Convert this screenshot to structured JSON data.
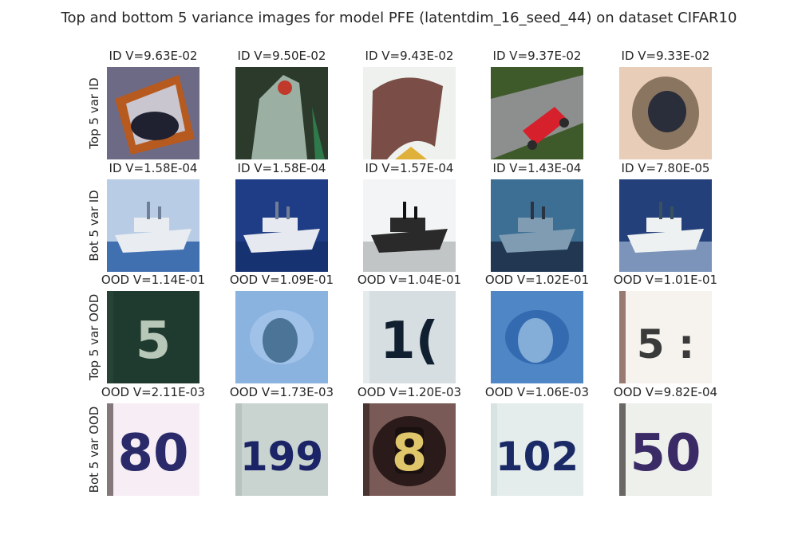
{
  "chart_data": {
    "type": "image_grid",
    "title": "Top and bottom 5 variance images for model PFE (latentdim_16_seed_44) on dataset CIFAR10",
    "rows": [
      {
        "label": "Top 5 var ID",
        "cells": [
          {
            "title": "ID V=9.63E-02",
            "variance": 0.0963,
            "icon": "cluttered-object-image",
            "palette": {
              "bg": "#6d6a86",
              "fg": "#c9c6cf",
              "accent": "#b65a1f",
              "dark": "#1f2030"
            }
          },
          {
            "title": "ID V=9.50E-02",
            "variance": 0.095,
            "icon": "parrot-image",
            "palette": {
              "bg": "#2b3a2a",
              "fg": "#9bb0a2",
              "accent": "#c0392b",
              "dark": "#2f7a4a"
            }
          },
          {
            "title": "ID V=9.43E-02",
            "variance": 0.0943,
            "icon": "bird-head-image",
            "palette": {
              "bg": "#eef1ee",
              "fg": "#7a4e46",
              "accent": "#e0b13a",
              "dark": "#5c4f22"
            }
          },
          {
            "title": "ID V=9.37E-02",
            "variance": 0.0937,
            "icon": "red-car-image",
            "palette": {
              "bg": "#3f5a2a",
              "fg": "#8c8f8e",
              "accent": "#d6202c",
              "dark": "#2a2a2a"
            }
          },
          {
            "title": "ID V=9.33E-02",
            "variance": 0.0933,
            "icon": "dog-face-image",
            "palette": {
              "bg": "#e8cdb8",
              "fg": "#8a7560",
              "accent": "#2a2d3a",
              "dark": "#5a4a3f"
            }
          }
        ]
      },
      {
        "label": "Bot 5 var ID",
        "cells": [
          {
            "title": "ID V=1.58E-04",
            "variance": 0.000158,
            "icon": "ship-image",
            "palette": {
              "bg": "#b9cce6",
              "fg": "#e9ecf0",
              "accent": "#2b5fa6",
              "dark": "#6f7f96"
            }
          },
          {
            "title": "ID V=1.58E-04",
            "variance": 0.000158,
            "icon": "ship-image",
            "palette": {
              "bg": "#1f3d86",
              "fg": "#e6e9ef",
              "accent": "#16306d",
              "dark": "#6f7d95"
            }
          },
          {
            "title": "ID V=1.57E-04",
            "variance": 0.000157,
            "icon": "ship-image",
            "palette": {
              "bg": "#f2f4f5",
              "fg": "#2a2a2a",
              "accent": "#b9bcbd",
              "dark": "#111111"
            }
          },
          {
            "title": "ID V=1.43E-04",
            "variance": 0.000143,
            "icon": "ship-image",
            "palette": {
              "bg": "#3d6f94",
              "fg": "#7f9cb2",
              "accent": "#1d2e46",
              "dark": "#2a3342"
            }
          },
          {
            "title": "ID V=7.80E-05",
            "variance": 7.8e-05,
            "icon": "ship-image",
            "palette": {
              "bg": "#24407a",
              "fg": "#eef1f2",
              "accent": "#8ca3c6",
              "dark": "#39515f"
            }
          }
        ]
      },
      {
        "label": "Top 5 var OOD",
        "cells": [
          {
            "title": "OOD V=1.14E-01",
            "variance": 0.114,
            "icon": "digit-image",
            "digits": "5",
            "palette": {
              "bg": "#1f3a2e",
              "fg": "#b8c8b8",
              "accent": "#2c4a3a",
              "dark": "#0f2018"
            }
          },
          {
            "title": "OOD V=1.09E-01",
            "variance": 0.109,
            "icon": "blurry-digit-image",
            "digits": "",
            "palette": {
              "bg": "#8bb3e0",
              "fg": "#2f5a7a",
              "accent": "#aac9ec",
              "dark": "#3d6a8a"
            }
          },
          {
            "title": "OOD V=1.04E-01",
            "variance": 0.104,
            "icon": "digit-image",
            "digits": "1(",
            "palette": {
              "bg": "#d6dee2",
              "fg": "#102030",
              "accent": "#eef2f4",
              "dark": "#0b1520"
            }
          },
          {
            "title": "OOD V=1.02E-01",
            "variance": 0.102,
            "icon": "blurry-digit-image",
            "digits": "",
            "palette": {
              "bg": "#4f86c6",
              "fg": "#9fc3e6",
              "accent": "#2a5fa6",
              "dark": "#6f9fd2"
            }
          },
          {
            "title": "OOD V=1.01E-01",
            "variance": 0.101,
            "icon": "digit-image",
            "digits": "5 :",
            "palette": {
              "bg": "#f6f3ee",
              "fg": "#3a3a3a",
              "accent": "#5a2a22",
              "dark": "#2a1410"
            }
          }
        ]
      },
      {
        "label": "Bot 5 var OOD",
        "cells": [
          {
            "title": "OOD V=2.11E-03",
            "variance": 0.00211,
            "icon": "digit-image",
            "digits": "80",
            "palette": {
              "bg": "#f6eef4",
              "fg": "#2a2a6a",
              "accent": "#3a2a2a",
              "dark": "#2a1a2a"
            }
          },
          {
            "title": "OOD V=1.73E-03",
            "variance": 0.00173,
            "icon": "digit-image",
            "digits": "199",
            "palette": {
              "bg": "#c9d3cf",
              "fg": "#1a2466",
              "accent": "#aeb9b6",
              "dark": "#13194a"
            }
          },
          {
            "title": "OOD V=1.20E-03",
            "variance": 0.0012,
            "icon": "digit-plate-image",
            "digits": "8",
            "palette": {
              "bg": "#7a5a56",
              "fg": "#e0c66a",
              "accent": "#2a1a1a",
              "dark": "#1a1010"
            }
          },
          {
            "title": "OOD V=1.06E-03",
            "variance": 0.00106,
            "icon": "digit-image",
            "digits": "102",
            "palette": {
              "bg": "#e4ecec",
              "fg": "#1a2a66",
              "accent": "#cfdcdc",
              "dark": "#16245a"
            }
          },
          {
            "title": "OOD V=9.82E-04",
            "variance": 0.000982,
            "icon": "digit-image",
            "digits": "50",
            "palette": {
              "bg": "#eef0ec",
              "fg": "#3a2a66",
              "accent": "#140c0c",
              "dark": "#2a1a44"
            }
          }
        ]
      }
    ]
  }
}
